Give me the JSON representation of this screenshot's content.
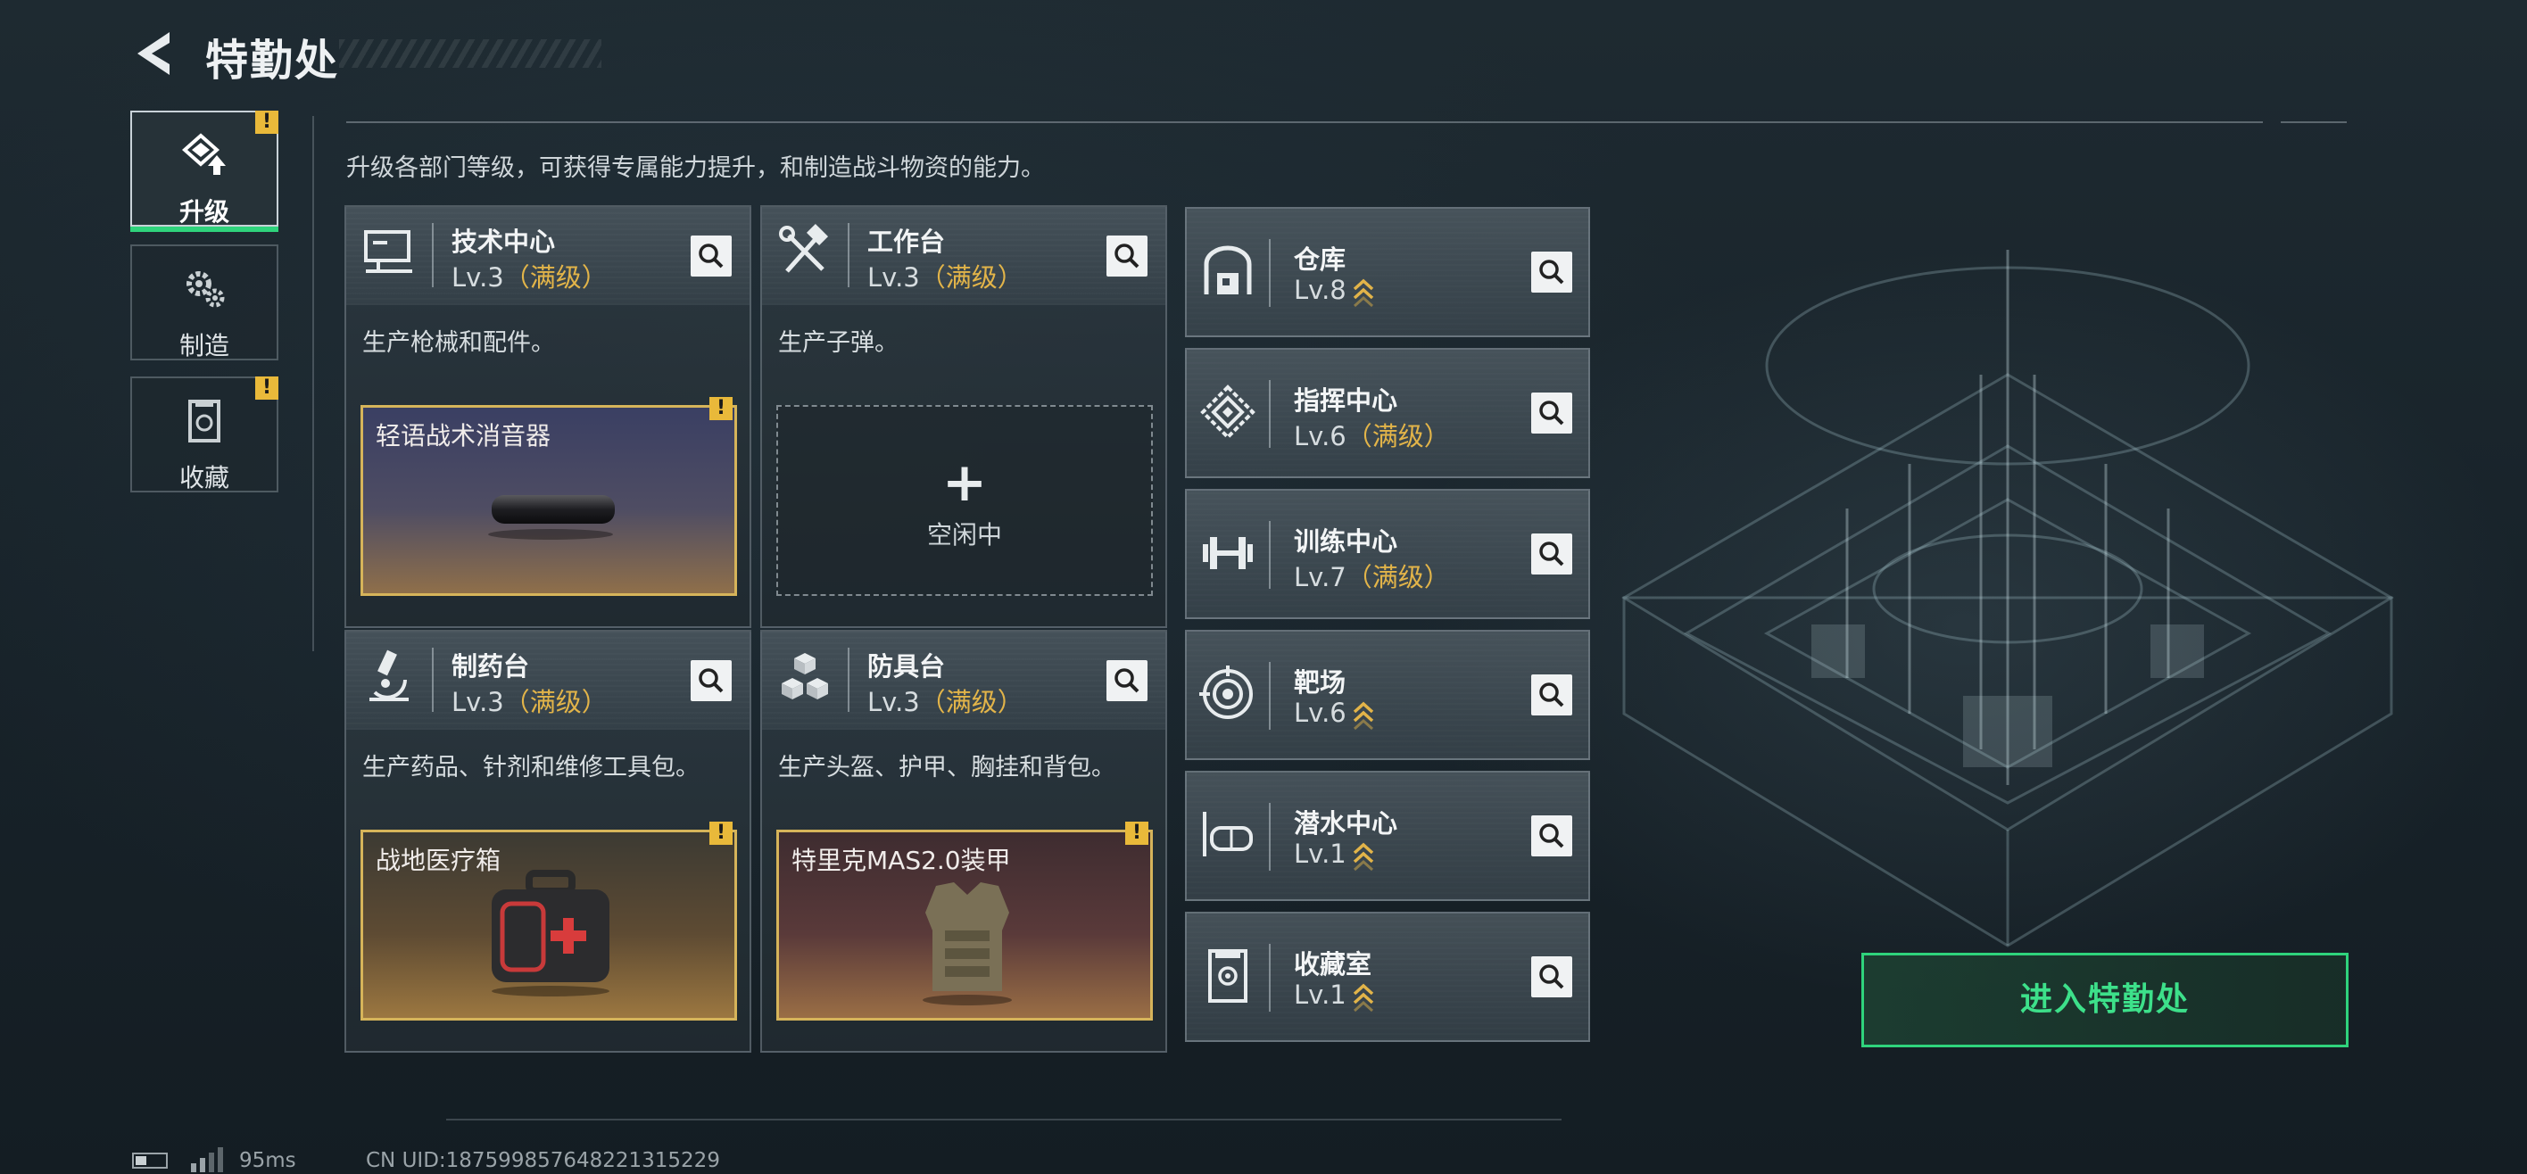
{
  "header": {
    "title": "特勤处"
  },
  "side_tabs": [
    {
      "label": "升级",
      "icon": "upgrade-icon",
      "active": true,
      "alert": "!"
    },
    {
      "label": "制造",
      "icon": "craft-gears-icon",
      "active": false,
      "alert": ""
    },
    {
      "label": "收藏",
      "icon": "collection-icon",
      "active": false,
      "alert": "!"
    }
  ],
  "subtitle": "升级各部门等级，可获得专属能力提升，和制造战斗物资的能力。",
  "departments": [
    {
      "name": "技术中心",
      "level": "Lv.3",
      "status": "（满级）",
      "icon": "computer-icon",
      "desc": "生产枪械和配件。",
      "slot": {
        "type": "item",
        "label": "轻语战术消音器",
        "alert": "!"
      }
    },
    {
      "name": "工作台",
      "level": "Lv.3",
      "status": "（满级）",
      "icon": "tools-icon",
      "desc": "生产子弹。",
      "slot": {
        "type": "empty",
        "plus": "+",
        "label": "空闲中"
      }
    },
    {
      "name": "制药台",
      "level": "Lv.3",
      "status": "（满级）",
      "icon": "microscope-icon",
      "desc": "生产药品、针剂和维修工具包。",
      "slot": {
        "type": "item",
        "label": "战地医疗箱",
        "alert": "!"
      }
    },
    {
      "name": "防具台",
      "level": "Lv.3",
      "status": "（满级）",
      "icon": "armor-blocks-icon",
      "desc": "生产头盔、护甲、胸挂和背包。",
      "slot": {
        "type": "item",
        "label": "特里克MAS2.0装甲",
        "alert": "!"
      }
    }
  ],
  "facilities": [
    {
      "name": "仓库",
      "level": "Lv.8",
      "status": "",
      "upgradable": true,
      "icon": "warehouse-icon"
    },
    {
      "name": "指挥中心",
      "level": "Lv.6",
      "status": "（满级）",
      "upgradable": false,
      "icon": "command-center-icon"
    },
    {
      "name": "训练中心",
      "level": "Lv.7",
      "status": "（满级）",
      "upgradable": false,
      "icon": "dumbbell-icon"
    },
    {
      "name": "靶场",
      "level": "Lv.6",
      "status": "",
      "upgradable": true,
      "icon": "target-icon"
    },
    {
      "name": "潜水中心",
      "level": "Lv.1",
      "status": "",
      "upgradable": true,
      "icon": "diving-mask-icon"
    },
    {
      "name": "收藏室",
      "level": "Lv.1",
      "status": "",
      "upgradable": true,
      "icon": "collection-room-icon"
    }
  ],
  "enter_button": {
    "label": "进入特勤处"
  },
  "footer": {
    "ping": "95ms",
    "uid": "CN UID:1875998576482213152​29"
  },
  "colors": {
    "accent_green": "#2fd37c",
    "max_level_gold": "#e2b449",
    "alert_yellow": "#e9b93a"
  }
}
